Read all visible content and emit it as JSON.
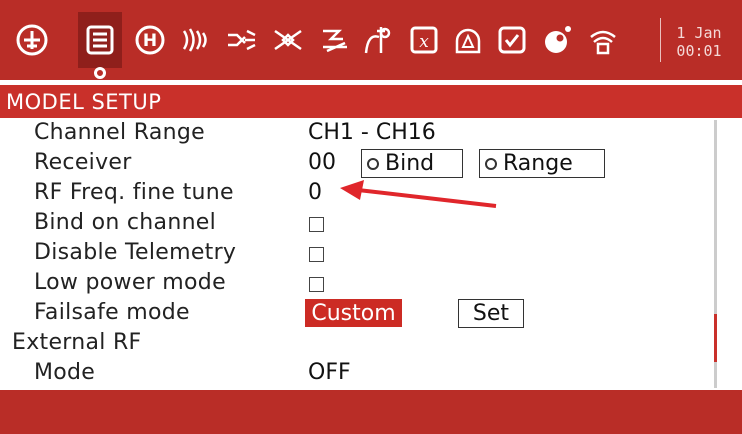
{
  "topbar": {
    "icons": [
      {
        "name": "airplane-icon"
      },
      {
        "name": "model-setup-list-icon",
        "active": true
      },
      {
        "name": "heli-icon",
        "glyph": "H"
      },
      {
        "name": "flight-modes-icon"
      },
      {
        "name": "inputs-icon"
      },
      {
        "name": "mixer-icon"
      },
      {
        "name": "outputs-icon"
      },
      {
        "name": "curves-icon"
      },
      {
        "name": "global-variables-icon",
        "glyph": "x"
      },
      {
        "name": "logical-switches-icon"
      },
      {
        "name": "special-functions-icon"
      },
      {
        "name": "lua-scripts-icon"
      },
      {
        "name": "telemetry-icon"
      }
    ],
    "date": "1 Jan",
    "time": "00:01"
  },
  "section_title": "MODEL SETUP",
  "rows": {
    "channel_range": {
      "label": "Channel Range",
      "value": "CH1 - CH16"
    },
    "receiver": {
      "label": "Receiver",
      "value": "00",
      "bind_label": "Bind",
      "range_label": "Range"
    },
    "rf_freq": {
      "label": "RF Freq. fine tune",
      "value": "0"
    },
    "bind_on_channel": {
      "label": "Bind on channel",
      "checked": false
    },
    "disable_telemetry": {
      "label": "Disable Telemetry",
      "checked": false
    },
    "low_power": {
      "label": "Low power mode",
      "checked": false
    },
    "failsafe": {
      "label": "Failsafe mode",
      "value": "Custom",
      "set_label": "Set"
    },
    "external_rf": {
      "label": "External RF"
    },
    "mode": {
      "label": "Mode",
      "value": "OFF"
    }
  },
  "colors": {
    "header": "#b92d27",
    "section": "#c9302a",
    "accent": "#cc2b24",
    "annotation": "#e0262b"
  }
}
